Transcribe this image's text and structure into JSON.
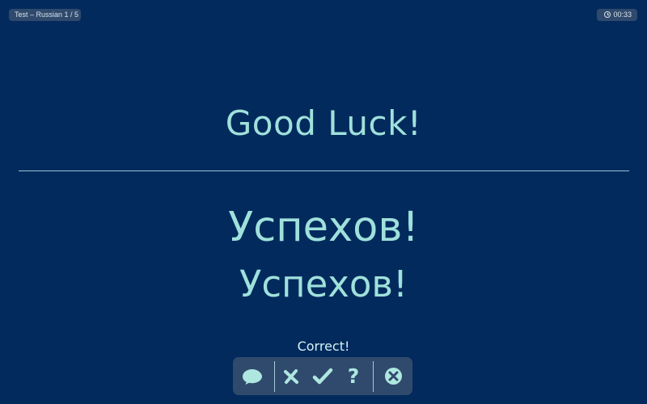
{
  "header": {
    "title": "Test – Russian 1 / 5",
    "timer": "00:33",
    "timer_icon": "clock-icon"
  },
  "card": {
    "prompt": "Good Luck!",
    "answer": "Успехов!",
    "typed_answer": "Успехов!",
    "feedback": "Correct!"
  },
  "toolbar": {
    "comment_icon": "speech-bubble-icon",
    "wrong_icon": "x-mark-icon",
    "right_icon": "checkmark-icon",
    "help_label": "?",
    "close_icon": "close-circle-icon"
  },
  "colors": {
    "background": "#032a5d",
    "text": "#9fe1db",
    "panel": "#304a6d"
  }
}
